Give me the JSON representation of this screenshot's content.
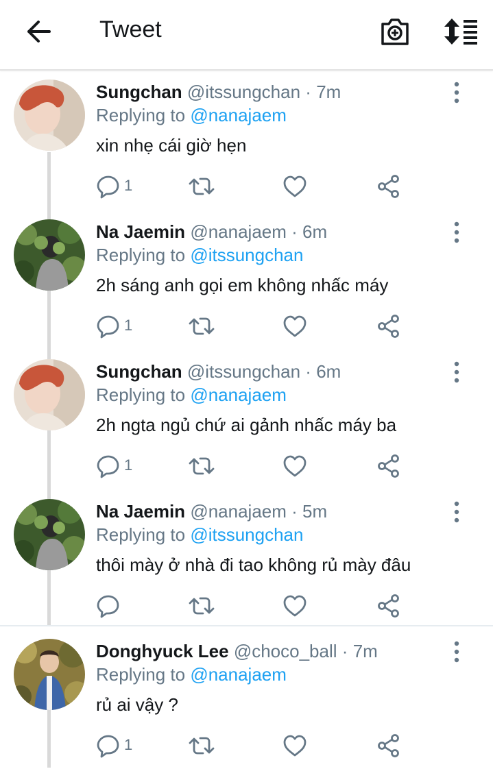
{
  "header": {
    "title": "Tweet"
  },
  "tweets": [
    {
      "name": "Sungchan",
      "handle": "@itssungchan",
      "dot": "·",
      "time": "7m",
      "replying_prefix": "Replying to",
      "replying_to": "@nanajaem",
      "text": "xin nhẹ cái giờ hẹn",
      "reply_count": "1"
    },
    {
      "name": "Na Jaemin",
      "handle": "@nanajaem",
      "dot": "·",
      "time": "6m",
      "replying_prefix": "Replying to",
      "replying_to": "@itssungchan",
      "text": "2h sáng anh gọi em không nhấc máy",
      "reply_count": "1"
    },
    {
      "name": "Sungchan",
      "handle": "@itssungchan",
      "dot": "·",
      "time": "6m",
      "replying_prefix": "Replying to",
      "replying_to": "@nanajaem",
      "text": "2h ngta ngủ chứ ai gảnh nhấc máy ba",
      "reply_count": "1"
    },
    {
      "name": "Na Jaemin",
      "handle": "@nanajaem",
      "dot": "·",
      "time": "5m",
      "replying_prefix": "Replying to",
      "replying_to": "@itssungchan",
      "text": "thôi mày ở nhà đi tao không rủ mày đâu",
      "reply_count": ""
    },
    {
      "name": "Donghyuck Lee",
      "handle": "@choco_ball",
      "dot": "·",
      "time": "7m",
      "replying_prefix": "Replying to",
      "replying_to": "@nanajaem",
      "text": "rủ ai vậy ?",
      "reply_count": "1"
    }
  ],
  "icons": {
    "back": "arrow-left-icon",
    "camera": "camera-plus-icon",
    "sort": "sort-icon",
    "more": "more-vertical-icon",
    "reply": "reply-icon",
    "retweet": "retweet-icon",
    "like": "heart-icon",
    "share": "share-icon"
  },
  "colors": {
    "mention": "#1da1f2",
    "secondary_text": "#657786",
    "primary_text": "#14171a"
  }
}
